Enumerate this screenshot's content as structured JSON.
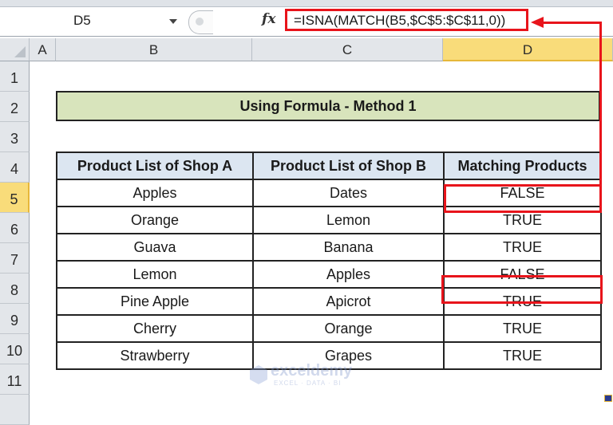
{
  "formula_bar": {
    "name_box": "D5",
    "fx_icon": "fx",
    "formula": "=ISNA(MATCH(B5,$C$5:$C$11,0))"
  },
  "columns": [
    "A",
    "B",
    "C",
    "D"
  ],
  "selected_column": "D",
  "rows": [
    "1",
    "2",
    "3",
    "4",
    "5",
    "6",
    "7",
    "8",
    "9",
    "10",
    "11"
  ],
  "selected_row": "5",
  "sheet": {
    "title": "Using Formula - Method 1",
    "headers": [
      "Product List of Shop A",
      "Product List of Shop B",
      "Matching Products"
    ],
    "data": [
      [
        "Apples",
        "Dates",
        "FALSE"
      ],
      [
        "Orange",
        "Lemon",
        "TRUE"
      ],
      [
        "Guava",
        "Banana",
        "TRUE"
      ],
      [
        "Lemon",
        "Apples",
        "FALSE"
      ],
      [
        "Pine Apple",
        "Apicrot",
        "TRUE"
      ],
      [
        "Cherry",
        "Orange",
        "TRUE"
      ],
      [
        "Strawberry",
        "Grapes",
        "TRUE"
      ]
    ]
  },
  "highlight_color": "#e8141b",
  "watermark": {
    "name": "exceldemy",
    "tagline": "EXCEL · DATA · BI"
  }
}
